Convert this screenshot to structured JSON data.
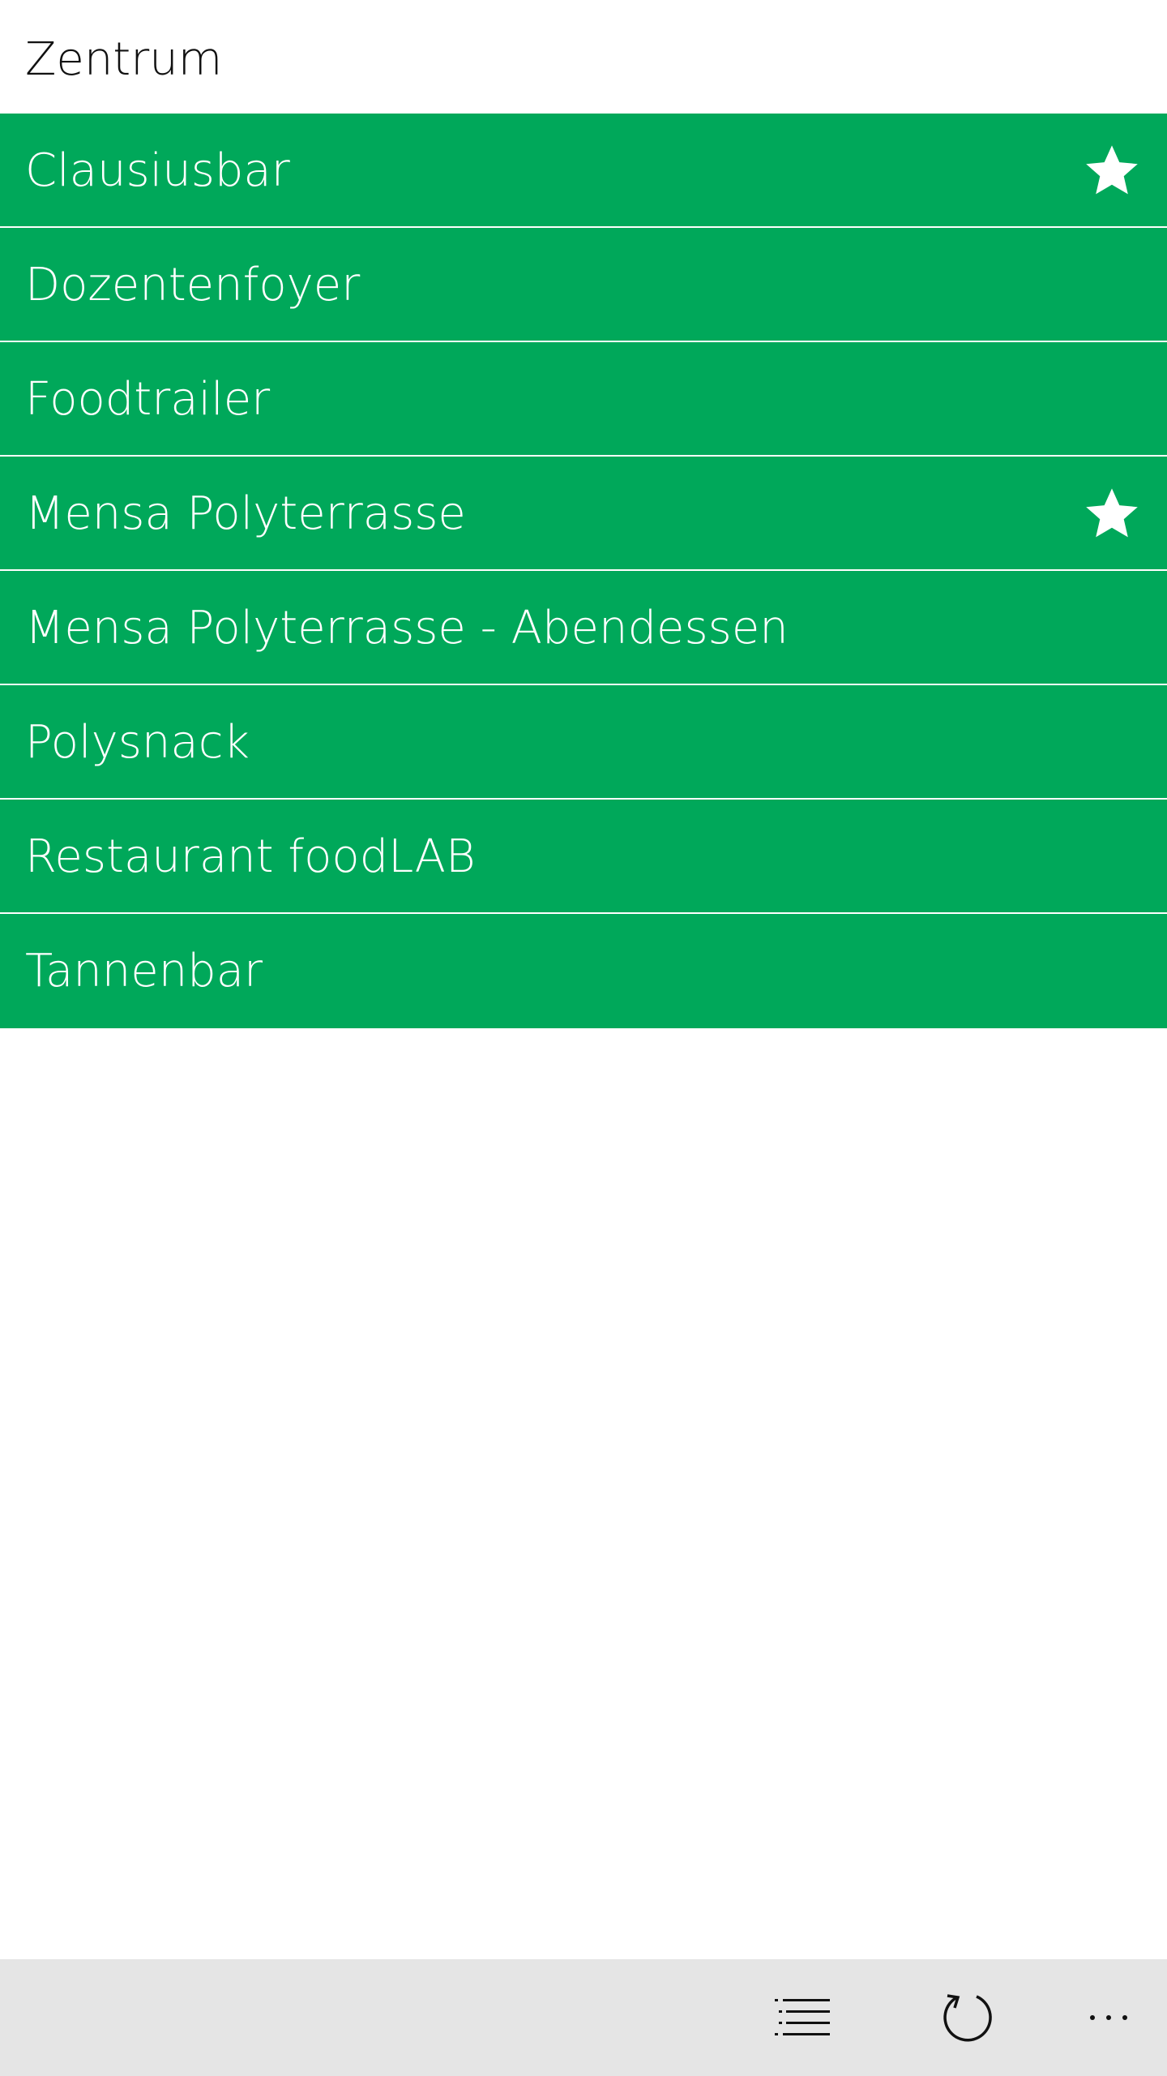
{
  "header": {
    "title": "Zentrum"
  },
  "list": {
    "items": [
      {
        "label": "Clausiusbar",
        "favorite": true
      },
      {
        "label": "Dozentenfoyer",
        "favorite": false
      },
      {
        "label": "Foodtrailer",
        "favorite": false
      },
      {
        "label": "Mensa Polyterrasse",
        "favorite": true
      },
      {
        "label": "Mensa Polyterrasse - Abendessen",
        "favorite": false
      },
      {
        "label": "Polysnack",
        "favorite": false
      },
      {
        "label": "Restaurant foodLAB",
        "favorite": false
      },
      {
        "label": "Tannenbar",
        "favorite": false
      }
    ],
    "item_color": "#00a85a",
    "favorite_icon": "star-icon"
  },
  "appbar": {
    "background": "#e5e5e5",
    "buttons": [
      {
        "icon": "list-icon"
      },
      {
        "icon": "refresh-icon"
      },
      {
        "icon": "more-icon"
      }
    ]
  }
}
